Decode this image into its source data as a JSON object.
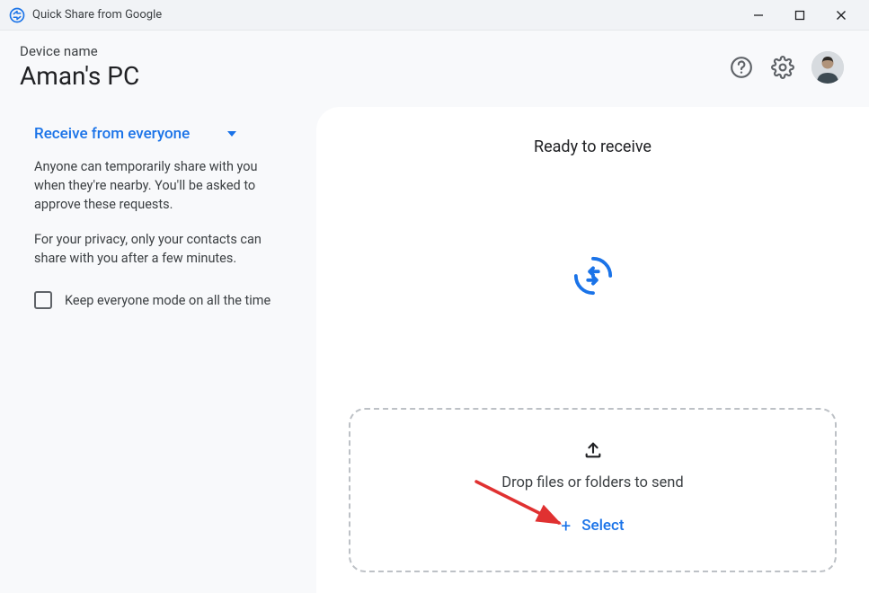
{
  "titlebar": {
    "title": "Quick Share from Google"
  },
  "header": {
    "device_label": "Device name",
    "device_name": "Aman's PC"
  },
  "sidebar": {
    "receive_label": "Receive from everyone",
    "desc1": "Anyone can temporarily share with you when they're nearby. You'll be asked to approve these requests.",
    "desc2": "For your privacy, only your contacts can share with you after a few minutes.",
    "checkbox_label": "Keep everyone mode on all the time"
  },
  "main": {
    "ready_title": "Ready to receive",
    "drop_text": "Drop files or folders to send",
    "select_label": "Select"
  }
}
